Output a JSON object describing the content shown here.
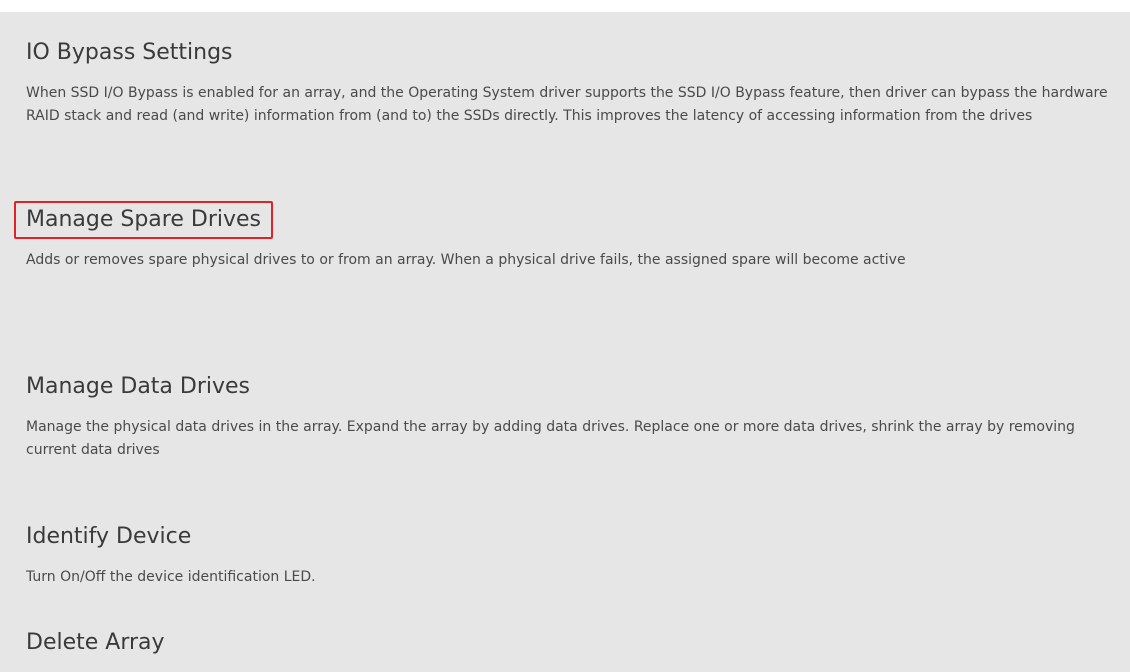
{
  "menu": {
    "items": [
      {
        "title": "IO Bypass Settings",
        "description": "When SSD I/O Bypass is enabled for an array, and the Operating System driver supports the SSD I/O Bypass feature, then driver can bypass the hardware RAID stack and read (and write) information from (and to) the SSDs directly. This improves the latency of accessing information from the drives"
      },
      {
        "title": "Manage Spare Drives",
        "description": "Adds or removes spare physical drives to or from an array. When a physical drive fails, the assigned spare will become active"
      },
      {
        "title": "Manage Data Drives",
        "description": "Manage the physical data drives in the array. Expand the array by adding data drives. Replace one or more data drives, shrink the array by removing current data drives"
      },
      {
        "title": "Identify Device",
        "description": "Turn On/Off the device identification LED."
      },
      {
        "title": "Delete Array",
        "description": ""
      }
    ]
  },
  "colors": {
    "background": "#e6e6e6",
    "highlight_border": "#e02424",
    "text": "#3d3d3d"
  }
}
